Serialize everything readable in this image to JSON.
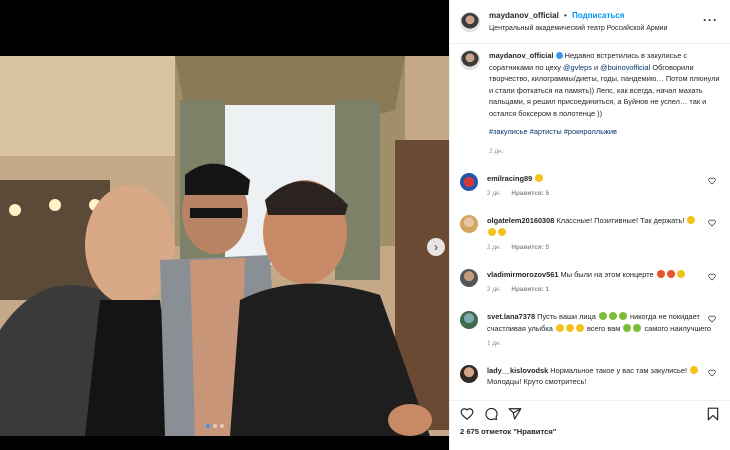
{
  "header": {
    "username": "maydanov_official",
    "follow_label": "Подписаться",
    "separator": "•",
    "location": "Центральный академический театр Российской Армии"
  },
  "post": {
    "username": "maydanov_official",
    "text_1": "Недавно встретились в закулисье с соратниками по цеху ",
    "mention_1": "@gvleps",
    "text_2": " и ",
    "mention_2": "@buinovofficial",
    "text_3": " Обговорили творчество, килограммы/диеты, годы, пандемию… Потом плюнули и стали фоткаться на память)) Лепс, как всегда, начал махать пальцами, я решил присоединиться, а Буйнов не успел… так и остался боксером в полотенце ))",
    "hashtags": "#закулисье #артисты #рокнролльжив",
    "time": "2 дн."
  },
  "comments": [
    {
      "username": "emilracing89",
      "text": "",
      "time": "2 дн.",
      "likes": "",
      "reply": "Нравится: 5?",
      "emojis": 1
    },
    {
      "username": "olgatelem20160308",
      "text": "Классные! Позитивные! Так держать!",
      "time": "2 дн.",
      "likes": "",
      "reply": "Нравится: 5?",
      "emojis": 3
    },
    {
      "username": "vladimirmorozov561",
      "text": "Мы были на этом концерте",
      "time": "2 дн.",
      "likes": "Нравится: 1",
      "reply": "",
      "emojis": 3
    },
    {
      "username": "svet.lana7378",
      "text_a": "Пусть ваши лица",
      "text_b": "никогда не покидает счастливая улыбка",
      "text_c": "всего вам",
      "text_d": "самого наилучшего",
      "time": "1 дн."
    },
    {
      "username": "lady__kislovodsk",
      "text": "Нормальное такое у вас там закулисье!",
      "text_2": "Молодцы! Круто смотритесь!"
    }
  ],
  "comment_meta": {
    "c1_time": "2 дн.",
    "c1_reply": "Нравится: 5",
    "c2_time": "2 дн.",
    "c2_reply": "Нравится: 5",
    "c3_time": "2 дн.",
    "c3_reply": "Нравится: 1",
    "c4_time": "1 дн."
  },
  "footer": {
    "likes": "2 675 отметок \"Нравится\""
  },
  "colors": {
    "link": "#00376b",
    "follow": "#0095f6",
    "muted": "#8e8e8e",
    "carousel_active": "#3897f0"
  },
  "icons": {
    "more": "more-dots-icon",
    "heart": "heart-icon",
    "comment": "comment-icon",
    "share": "share-icon",
    "bookmark": "bookmark-icon",
    "next": "chevron-right-icon"
  }
}
